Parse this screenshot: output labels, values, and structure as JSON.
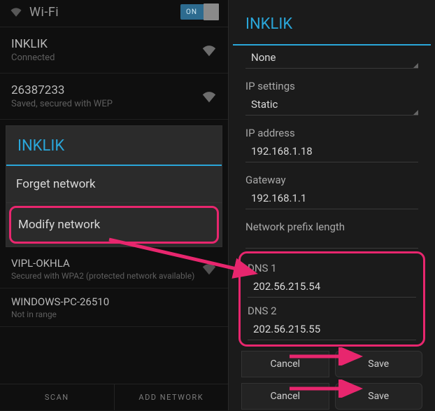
{
  "left": {
    "header_title": "Wi-Fi",
    "toggle_label": "ON",
    "networks": [
      {
        "name": "INKLIK",
        "status": "Connected"
      },
      {
        "name": "26387233",
        "status": "Saved, secured with WEP"
      }
    ],
    "dialog": {
      "title": "INKLIK",
      "forget": "Forget network",
      "modify": "Modify network"
    },
    "more_networks": [
      {
        "name": "VIPL-OKHLA",
        "status": "Secured with WPA2 (protected network available)"
      },
      {
        "name": "WINDOWS-PC-26510",
        "status": "Not in range"
      }
    ],
    "scan": "SCAN",
    "add": "ADD NETWORK"
  },
  "right": {
    "title": "INKLIK",
    "proxy_value": "None",
    "ip_settings_label": "IP settings",
    "ip_settings_value": "Static",
    "ip_address_label": "IP address",
    "ip_address_value": "192.168.1.18",
    "gateway_label": "Gateway",
    "gateway_value": "192.168.1.1",
    "prefix_label": "Network prefix length",
    "prefix_value": "",
    "dns1_label": "DNS 1",
    "dns1_value": "202.56.215.54",
    "dns2_label": "DNS 2",
    "dns2_value": "202.56.215.55",
    "cancel": "Cancel",
    "save": "Save"
  }
}
